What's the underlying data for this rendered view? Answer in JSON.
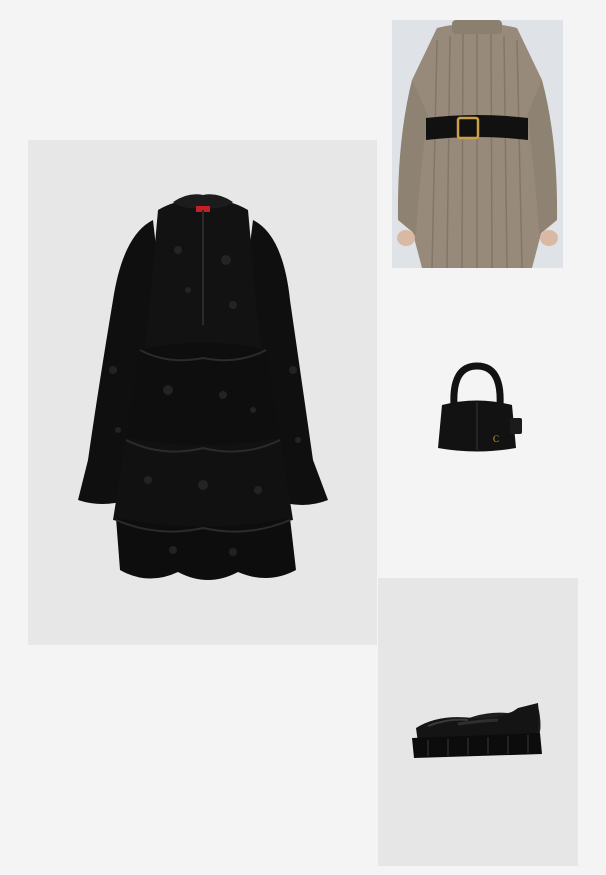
{
  "board": {
    "background": "#f4f4f4",
    "items": [
      {
        "id": "dress",
        "kind": "black lace tiered mini dress",
        "color": "#0f0f0f",
        "tile_color": "#e7e7e7"
      },
      {
        "id": "sweater",
        "kind": "ribbed knit sweater dress with belt",
        "color": "#978a7a",
        "tile_color": "#dfe2e6"
      },
      {
        "id": "bag",
        "kind": "black leather top-handle bag",
        "color": "#121212",
        "tile_color": "#f4f4f4"
      },
      {
        "id": "shoes",
        "kind": "black chunky platform loafers",
        "color": "#141414",
        "tile_color": "#e6e6e6"
      }
    ]
  },
  "labels": {
    "dress_brand_tag": "",
    "bag_logo": "C"
  }
}
